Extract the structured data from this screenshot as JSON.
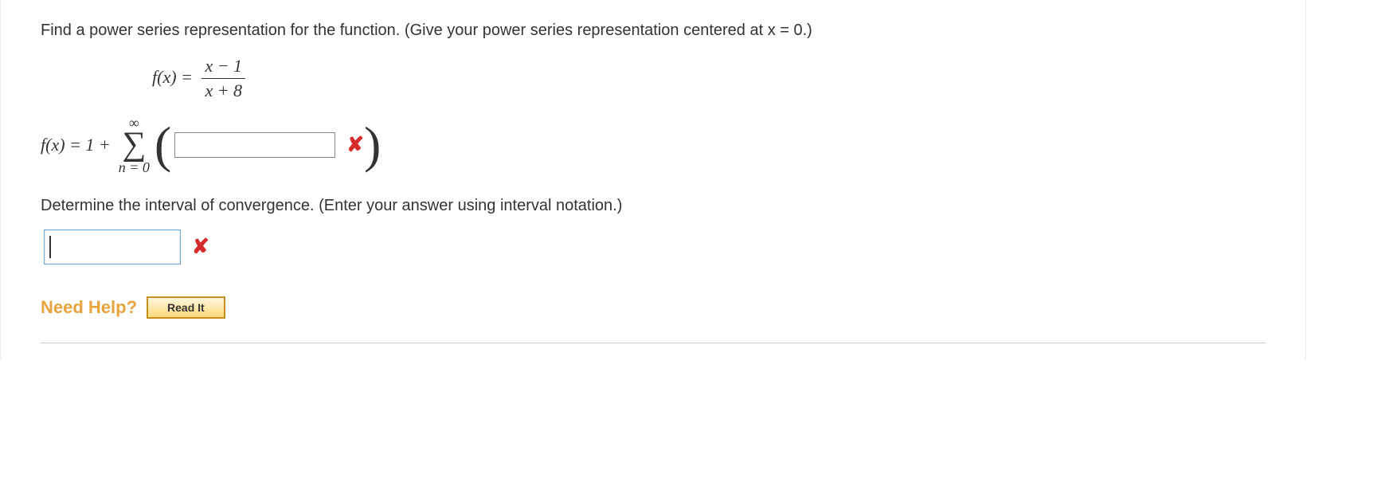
{
  "prompt": "Find a power series representation for the function. (Give your power series representation centered at x = 0.)",
  "function": {
    "lhs": "f(x) =",
    "num": "x − 1",
    "den": "x + 8"
  },
  "series": {
    "lhs": "f(x) = 1 +",
    "sigma_top": "∞",
    "sigma_bottom": "n = 0",
    "paren_open": "(",
    "paren_close": ")",
    "answer_value": ""
  },
  "interval_prompt": "Determine the interval of convergence. (Enter your answer using interval notation.)",
  "interval_answer": "",
  "wrong_marks": {
    "series": "✘",
    "interval": "✘"
  },
  "need_help": {
    "label": "Need Help?",
    "read_it": "Read It"
  }
}
